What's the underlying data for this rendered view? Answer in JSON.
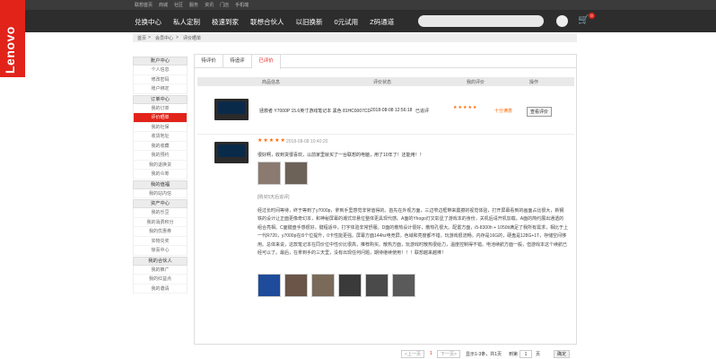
{
  "brand": "Lenovo",
  "topbar": {
    "links": [
      "联想首页",
      "商城",
      "社区",
      "服务",
      "资讯",
      "门店",
      "手机端"
    ]
  },
  "nav": {
    "items": [
      "兑换中心",
      "私人定制",
      "极速到家",
      "联想合伙人",
      "以旧换新",
      "0元试用",
      "Z码通道"
    ],
    "cart_count": "0"
  },
  "breadcrumb": {
    "home": "首页",
    "sep1": ">",
    "center": "会员中心",
    "sep2": ">",
    "current": "评价晒单"
  },
  "sidebar": [
    {
      "head": "账户中心",
      "items": [
        "个人信息",
        "修改密码",
        "账户绑定"
      ]
    },
    {
      "head": "订单中心",
      "items": [
        "我的订单",
        "评价晒单",
        "我的社保",
        "收货地址",
        "我的收藏",
        "我的预约",
        "我的退换货",
        "我的众筹"
      ]
    },
    {
      "head": "我的值福",
      "items": [
        "我的站内信"
      ]
    },
    {
      "head": "资产中心",
      "items": [
        "我的乐豆",
        "我的消费积分",
        "我的优惠券",
        "实物兑奖",
        "惊喜中心"
      ]
    },
    {
      "head": "我的合伙人",
      "items": [
        "我的推广",
        "我的红益点",
        "我的邀请"
      ]
    }
  ],
  "sidebar_active": "评价晒单",
  "tabs": [
    "待评价",
    "待追评",
    "已评价"
  ],
  "active_tab": "已评价",
  "table_headers": {
    "product": "商品信息",
    "status": "评价状态",
    "my_review": "我的评价",
    "ops": "操作"
  },
  "review_row": {
    "product_name": "拯救者 Y7000P 15.6英寸游戏笔记本 黑色 81HC0007CD",
    "date": "2018-08-08 12:56:18",
    "status": "已追评",
    "stars": "★★★★★",
    "rating_label": "十分满意",
    "view_btn": "查看评价"
  },
  "review_detail": {
    "stars": "★★★★★",
    "date": "2018-08-08 10:40:20",
    "headline": "很好啊，收到货很喜欢，以前家里就买了一台联想的电脑，用了10年了！还能用！！",
    "followup_label": "[购买5天后追评]",
    "paragraph": "经过长时间等待，终于等到了y7000p，拿到手里感觉非常值得的。首先在外观方面，三边窄边框带来震撼的视觉体验，打开屏幕看到的画面占比很大，新钢铁的设计让正面更像奇幻本，和神秘屏幕的潮式非悬位整体更具现代感。A面的Yhogo灯又彰显了游戏本的身份，关机后请开机加载。A面的简约展出通透的组合亮相。C面键盘手感很好，键程适中，打字体验非常舒服。D面的散热设计很好，散热孔很大。配置方面，i5-8300h + 1050ti满足了我所有需求，相比于上一代R720，y7000p在i5个位提升，0卡性能更强。屏幕方面144hz电竞屏，色域和亮度都不错，玩游戏很流畅。内存是16G的，硬盘是128G+1T，存储空间够用。总体来说，这款笔记本在同价位中性价比很高，推荐购买。散热方面，玩游戏时散热很给力，温度控制得不错。电池续航方面一般，但游戏本这个续航已经可以了。最后，在拿到手的三天里，没有出现任何问题，期待继续使用！！！联想越来越棒！"
  },
  "pager": {
    "prev": "<上一页",
    "page": "1",
    "next": "下一页>",
    "info": "显示1-3条，共1页",
    "goto_label": "到第",
    "goto_value": "1",
    "page_unit": "页",
    "confirm": "确定"
  }
}
